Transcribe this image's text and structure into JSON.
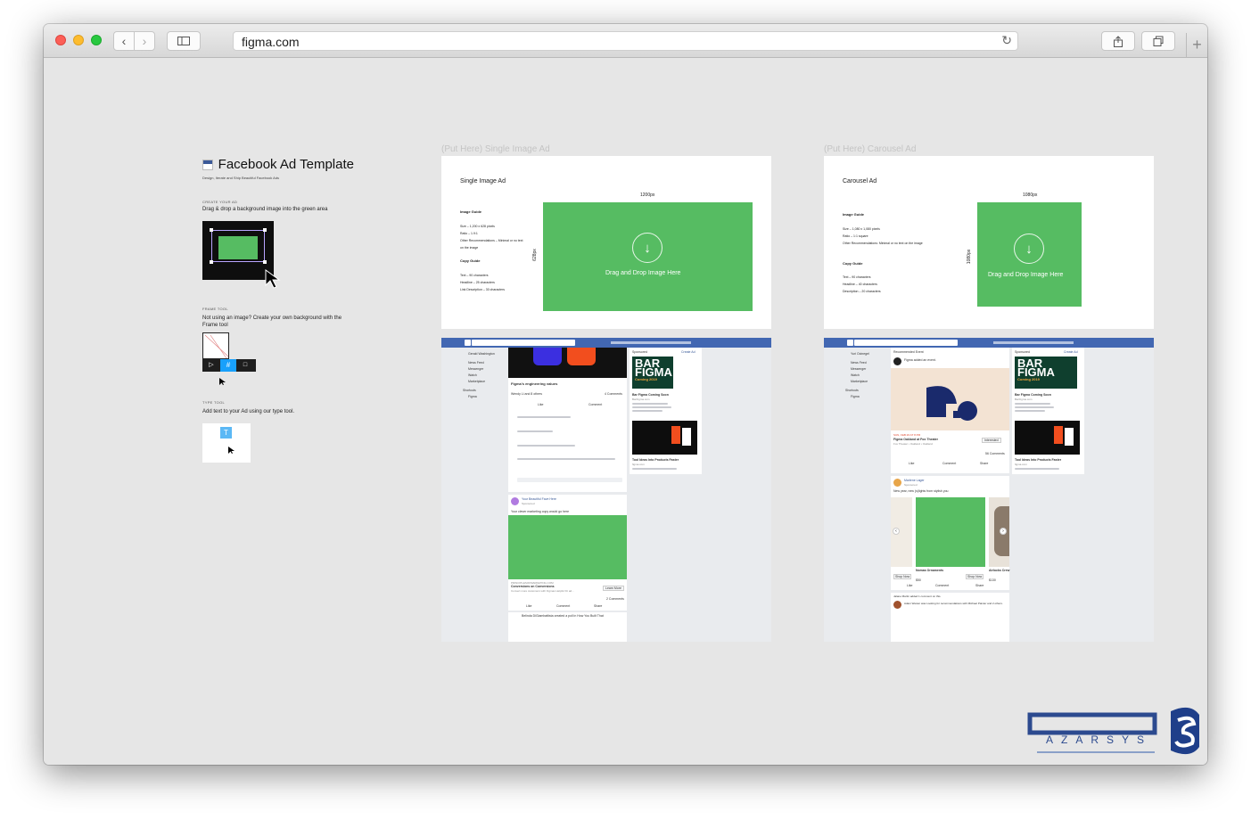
{
  "browser": {
    "url": "figma.com"
  },
  "template": {
    "title": "Facebook Ad Template",
    "subtitle": "Design, Iterate and Ship Beautiful Facebook Ads",
    "create_heading": "CREATE YOUR AD",
    "create_text": "Drag & drop a background image into the green area",
    "frame_heading": "FRAME TOOL",
    "frame_text": "Not using an image?  Create your own background with the Frame tool",
    "type_heading": "TYPE TOOL",
    "type_text": "Add text to your Ad using our type tool."
  },
  "single": {
    "frame_label": "(Put Here) Single Image Ad",
    "title": "Single Image Ad",
    "width_label": "1200px",
    "height_label": "628px",
    "guide_title": "Image Guide",
    "guide_lines": [
      "Size – 1,200 x 628 pixels",
      "Ratio – 1.9:1",
      "Other Recommendations – Minimal or no text",
      "on the image"
    ],
    "copy_title": "Copy Guide",
    "copy_lines": [
      "Text – 90 characters",
      "Headline – 25 characters",
      "Link Description – 30 characters"
    ],
    "drop_text": "Drag and Drop Image Here"
  },
  "carousel": {
    "frame_label": "(Put Here) Carousel Ad",
    "title": "Carousel Ad",
    "width_label": "1080px",
    "height_label": "1080px",
    "guide_title": "Image Guide",
    "guide_lines": [
      "Size – 1,080 x 1,080 pixels",
      "Ratio – 1:1 square",
      "Other Recommendations: Minimal or no text on the image"
    ],
    "copy_title": "Copy Guide",
    "copy_lines": [
      "Text – 90 characters",
      "Headline – 40 characters",
      "Description – 20 characters"
    ],
    "drop_text": "Drag and Drop Image Here"
  },
  "fb_single": {
    "sidebar": [
      "Gerald Washington",
      "News Feed",
      "Messenger",
      "Watch",
      "Marketplace",
      "Shortcuts",
      "Figma"
    ],
    "post_title": "Figma's engineering values",
    "post_reactions": "Wendy Li and 8 others",
    "post_comments": "4 Comments",
    "like": "Like",
    "comment": "Comment",
    "share": "Share",
    "ad_name": "Your Beautiful Fave Here",
    "ad_sponsored": "Sponsored",
    "ad_copy": "Your clever marketing copy would go here",
    "ad_link_domain": "PRINCIPLESOFMARKETING.COM",
    "ad_headline": "Conversions on Conversions",
    "ad_link_desc": "Convert more customers with Figmas Helpful Fit ad...",
    "learn_more": "Learn More",
    "ad_comments": "2 Comments",
    "last_post": "Belinda DiGiambattista created a poll in How You Built That",
    "sponsored": "Sponsored",
    "create_ad": "Create Ad",
    "bar_logo": "BAR FIGMA",
    "bar_coming": "Coming 2019",
    "bar_title": "Bar Figma Coming Soon",
    "bar_domain": "BarFigma.com",
    "tool_title": "Tool Ideas Into Products Faster",
    "tool_domain": "figma.com"
  },
  "fb_carousel": {
    "sidebar": [
      "Yuri Ocinegel",
      "News Feed",
      "Messenger",
      "Watch",
      "Marketplace",
      "Shortcuts",
      "Figma"
    ],
    "event_header": "Recommended Event",
    "event_added": "Figma added an event.",
    "event_date": "SUN, FEB 26 AT 8 PM",
    "event_title": "Figma Oakland at Fox Theater",
    "event_place": "Fox Theater • Oakland • Oakland",
    "interested": "Interested",
    "event_comments": "56 Comments",
    "ad_name": "Marlene Lager",
    "ad_copy": "New year, new (s)lights from stylish you",
    "item1": "Nomas Ornaments",
    "item2": "Airlocks Crew",
    "shop_now": "Shop Now",
    "price1": "$50",
    "price2": "$130",
    "commented": "Jalane Martin added 1 comment on this.",
    "last_post": "Adam Wester was Looking for recommendations with Michael Painter and 2 others."
  }
}
